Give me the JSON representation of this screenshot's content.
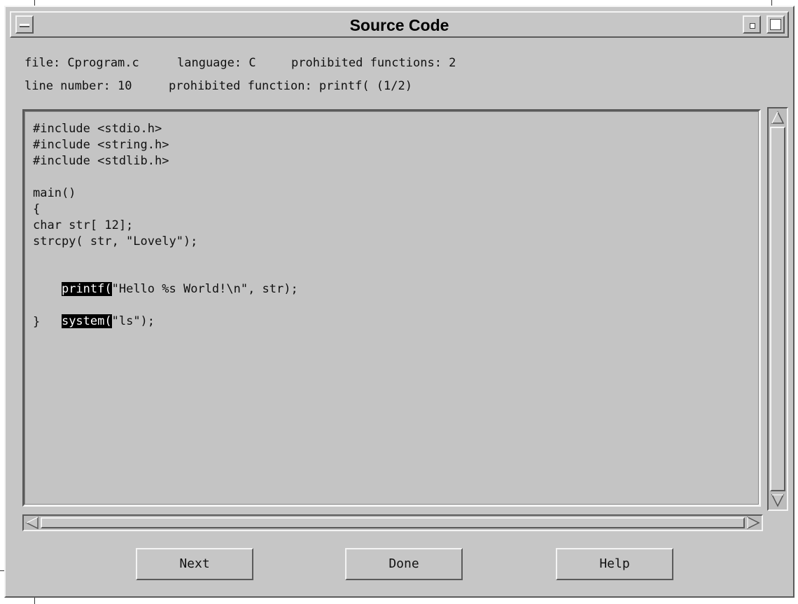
{
  "window": {
    "title": "Source Code"
  },
  "info": {
    "file": "file: Cprogram.c",
    "language": "language: C",
    "prohibited_count": "prohibited functions: 2",
    "line_number": "line number: 10",
    "prohibited_function": "prohibited function: printf( (1/2)"
  },
  "code": {
    "lines": [
      "#include <stdio.h>",
      "#include <string.h>",
      "#include <stdlib.h>",
      "",
      "main()",
      "{",
      "char str[ 12];",
      "strcpy( str, \"Lovely\");",
      "",
      "printf(",
      "",
      "system(",
      "}"
    ],
    "line10_rest": "\"Hello %s World!\\n\", str);",
    "line12_rest": "\"ls\");"
  },
  "buttons": {
    "next": "Next",
    "done": "Done",
    "help": "Help"
  },
  "icons": {
    "menu": "window-menu-icon",
    "minimize": "minimize-icon",
    "maximize": "maximize-icon",
    "scroll_up": "arrow-up-icon",
    "scroll_down": "arrow-down-icon",
    "scroll_left": "arrow-left-icon",
    "scroll_right": "arrow-right-icon"
  },
  "colors": {
    "window_bg": "#c6c6c6",
    "highlight_bg": "#000000",
    "highlight_fg": "#ffffff"
  }
}
